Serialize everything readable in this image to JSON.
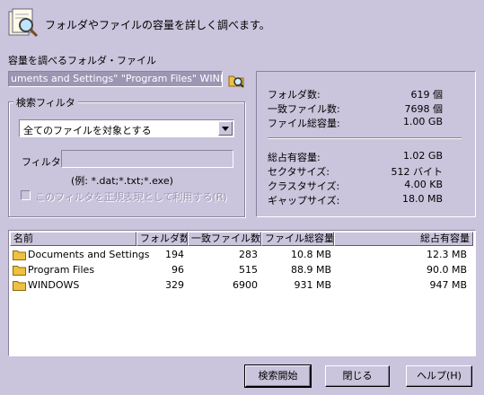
{
  "header": {
    "text": "フォルダやファイルの容量を詳しく調べます。"
  },
  "path": {
    "label": "容量を調べるフォルダ・ファイル",
    "value": "uments and Settings\" \"Program Files\" WINDOWS"
  },
  "filter": {
    "group_title": "検索フィルタ",
    "selected_option": "全てのファイルを対象とする",
    "filter_label": "フィルタ(F):",
    "filter_value": "",
    "hint": "(例: *.dat;*.txt;*.exe)",
    "regex_label": "このフィルタを正規表現として利用する(R)",
    "regex_checked": false
  },
  "stats": {
    "folder_count_label": "フォルダ数:",
    "folder_count_value": "619 個",
    "match_count_label": "一致ファイル数:",
    "match_count_value": "7698 個",
    "total_size_label": "ファイル総容量:",
    "total_size_value": "1.00 GB",
    "occupied_label": "総占有容量:",
    "occupied_value": "1.02 GB",
    "sector_label": "セクタサイズ:",
    "sector_value": "512 バイト",
    "cluster_label": "クラスタサイズ:",
    "cluster_value": "4.00 KB",
    "gap_label": "ギャップサイズ:",
    "gap_value": "18.0 MB"
  },
  "table": {
    "columns": [
      "名前",
      "フォルダ数",
      "一致ファイル数",
      "ファイル総容量",
      "総占有容量"
    ],
    "rows": [
      {
        "name": "Documents and Settings",
        "folders": "194",
        "files": "283",
        "total": "10.8 MB",
        "occupied": "12.3 MB"
      },
      {
        "name": "Program Files",
        "folders": "96",
        "files": "515",
        "total": "88.9 MB",
        "occupied": "90.0 MB"
      },
      {
        "name": "WINDOWS",
        "folders": "329",
        "files": "6900",
        "total": "931 MB",
        "occupied": "947 MB"
      }
    ]
  },
  "buttons": {
    "search": "検索開始",
    "close": "閉じる",
    "help": "ヘルプ(H)"
  },
  "colors": {
    "background": "#cac4dc",
    "highlight": "#9c96b4",
    "folder": "#f0c040"
  }
}
